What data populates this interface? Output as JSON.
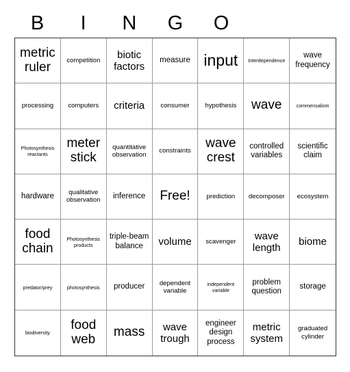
{
  "card": {
    "title": "BINGO",
    "header_letters": [
      "B",
      "I",
      "N",
      "G",
      "O",
      "",
      ""
    ],
    "columns": 7,
    "rows": 7,
    "free_space_label": "Free!",
    "border_color": "#333333",
    "gridline_color": "#9a9a9a",
    "background_color": "#ffffff",
    "text_color": "#000000"
  },
  "cells": [
    {
      "text": "metric ruler",
      "size": "xl"
    },
    {
      "text": "competition",
      "size": "s"
    },
    {
      "text": "biotic factors",
      "size": "l"
    },
    {
      "text": "measure",
      "size": "m"
    },
    {
      "text": "input",
      "size": "xxl"
    },
    {
      "text": "Interdependence",
      "size": "xs"
    },
    {
      "text": "wave frequency",
      "size": "m"
    },
    {
      "text": "processing",
      "size": "s"
    },
    {
      "text": "computers",
      "size": "s"
    },
    {
      "text": "criteria",
      "size": "l"
    },
    {
      "text": "consumer",
      "size": "s"
    },
    {
      "text": "hypothesis",
      "size": "s"
    },
    {
      "text": "wave",
      "size": "xl"
    },
    {
      "text": "commensalism",
      "size": "xs"
    },
    {
      "text": "Photosynthesis reactants",
      "size": "xs"
    },
    {
      "text": "meter stick",
      "size": "xl"
    },
    {
      "text": "quantitative observation",
      "size": "s"
    },
    {
      "text": "constraints",
      "size": "s"
    },
    {
      "text": "wave crest",
      "size": "xl"
    },
    {
      "text": "controlled variables",
      "size": "m"
    },
    {
      "text": "scientific claim",
      "size": "m"
    },
    {
      "text": "hardware",
      "size": "m"
    },
    {
      "text": "qualitative observation",
      "size": "s"
    },
    {
      "text": "inference",
      "size": "m"
    },
    {
      "text": "Free!",
      "size": "xl"
    },
    {
      "text": "prediction",
      "size": "s"
    },
    {
      "text": "decomposer",
      "size": "s"
    },
    {
      "text": "ecosystem",
      "size": "s"
    },
    {
      "text": "food chain",
      "size": "xl"
    },
    {
      "text": "Photosynthesis products",
      "size": "xs"
    },
    {
      "text": "triple-beam balance",
      "size": "m"
    },
    {
      "text": "volume",
      "size": "l"
    },
    {
      "text": "scavenger",
      "size": "s"
    },
    {
      "text": "wave length",
      "size": "l"
    },
    {
      "text": "biome",
      "size": "l"
    },
    {
      "text": "predator/prey",
      "size": "xs"
    },
    {
      "text": "photosynthesis",
      "size": "xs"
    },
    {
      "text": "producer",
      "size": "m"
    },
    {
      "text": "dependent variable",
      "size": "s"
    },
    {
      "text": "independent variable",
      "size": "xs"
    },
    {
      "text": "problem question",
      "size": "m"
    },
    {
      "text": "storage",
      "size": "m"
    },
    {
      "text": "biodiversity",
      "size": "xs"
    },
    {
      "text": "food web",
      "size": "xl"
    },
    {
      "text": "mass",
      "size": "xl"
    },
    {
      "text": "wave trough",
      "size": "l"
    },
    {
      "text": "engineer design process",
      "size": "m"
    },
    {
      "text": "metric system",
      "size": "l"
    },
    {
      "text": "graduated cylinder",
      "size": "s"
    }
  ]
}
